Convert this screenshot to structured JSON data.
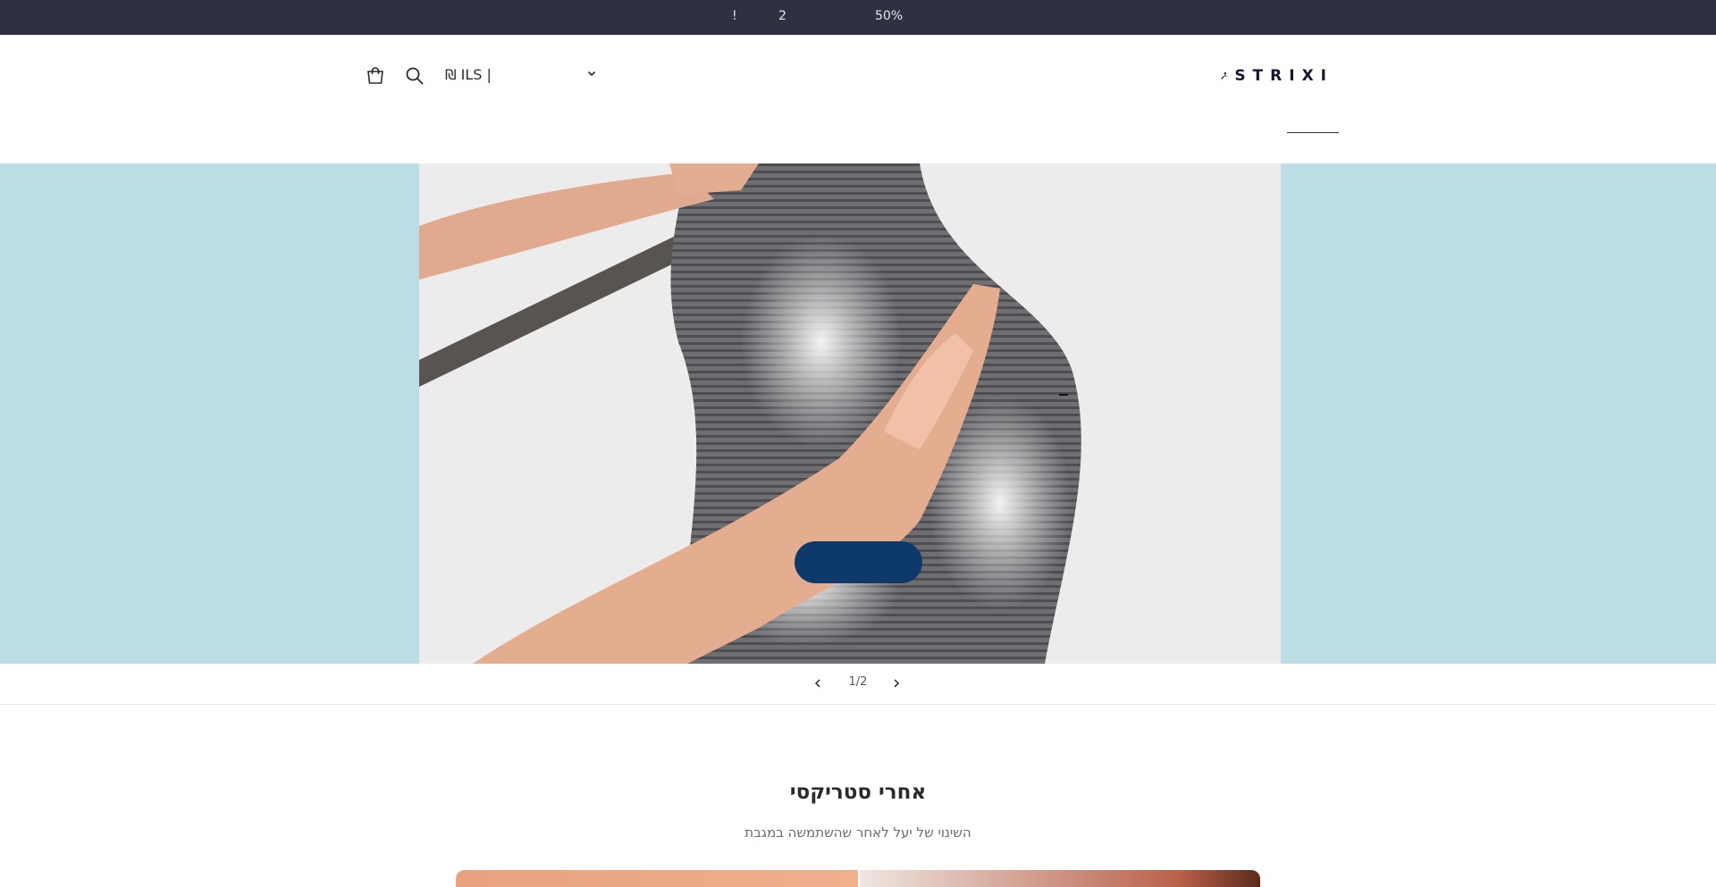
{
  "announcement": {
    "part_1": "!",
    "part_2": "2",
    "part_3": "50%"
  },
  "header": {
    "currency": {
      "value": "₪ ILS |"
    },
    "logo": {
      "text": "STRIXI"
    },
    "icons": [
      "cart-icon",
      "search-icon",
      "chevron-down-icon"
    ]
  },
  "hero": {
    "background_color": "#bcdde6",
    "cta_color": "#0d3a6b",
    "slide_indicator": "1/2"
  },
  "section": {
    "title": "אחרי סטריקסי ",
    "subtitle": "השינוי של יעל לאחר שהשתמשה במגבת"
  },
  "colors": {
    "announcement_bg": "#2f3040",
    "text": "#2b2b2b"
  }
}
